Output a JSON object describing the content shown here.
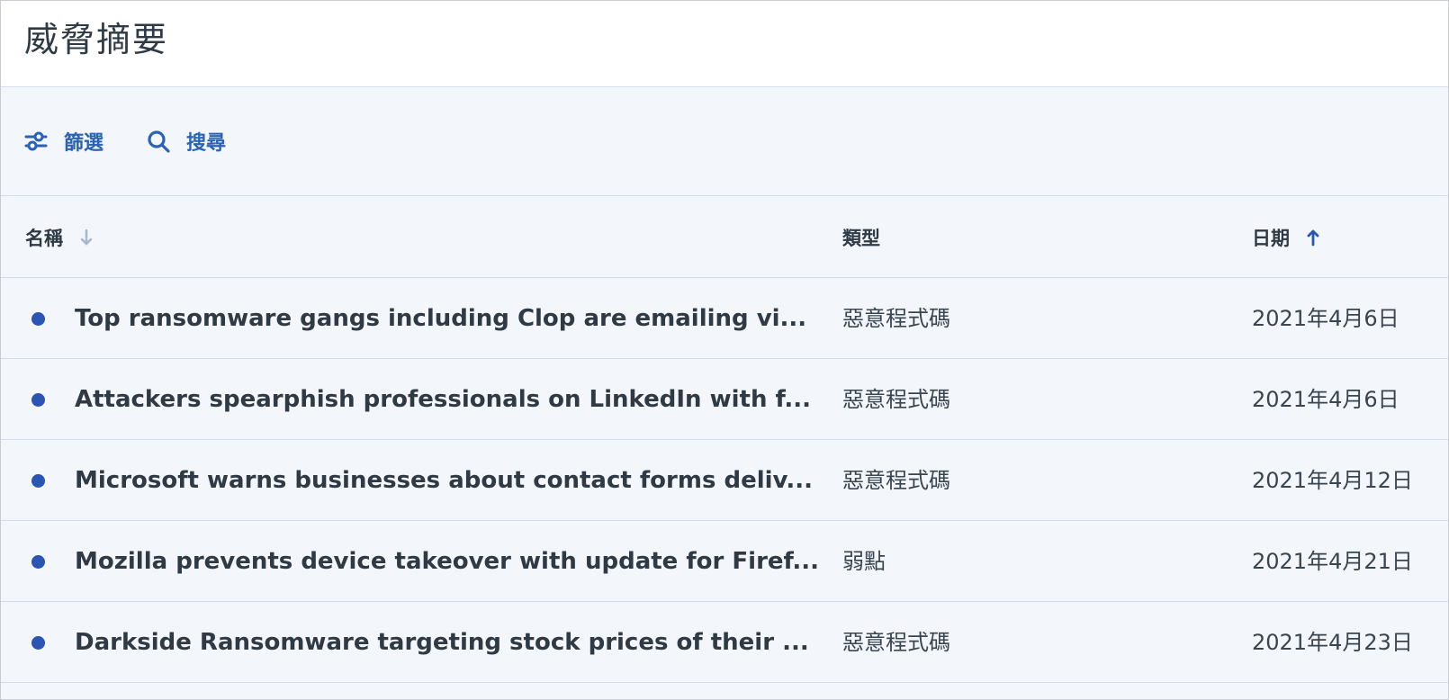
{
  "header": {
    "title": "威脅摘要"
  },
  "toolbar": {
    "filter_label": "篩選",
    "filter_icon": "sliders-icon",
    "search_label": "搜尋",
    "search_icon": "search-icon"
  },
  "table": {
    "columns": {
      "name": "名稱",
      "type": "類型",
      "date": "日期"
    },
    "sort": {
      "name": "descending-inactive",
      "date": "ascending-active"
    },
    "rows": [
      {
        "name": "Top ransomware gangs including Clop are emailing vi...",
        "type": "惡意程式碼",
        "date": "2021年4月6日"
      },
      {
        "name": "Attackers spearphish professionals on LinkedIn with f...",
        "type": "惡意程式碼",
        "date": "2021年4月6日"
      },
      {
        "name": "Microsoft warns businesses about contact forms deliv...",
        "type": "惡意程式碼",
        "date": "2021年4月12日"
      },
      {
        "name": "Mozilla prevents device takeover with update for Firef...",
        "type": "弱點",
        "date": "2021年4月21日"
      },
      {
        "name": "Darkside Ransomware targeting stock prices of their ...",
        "type": "惡意程式碼",
        "date": "2021年4月23日"
      }
    ]
  },
  "colors": {
    "accent": "#2a63b6",
    "dot": "#2a55b3",
    "background": "#f3f6fb",
    "text": "#2f3a45"
  }
}
